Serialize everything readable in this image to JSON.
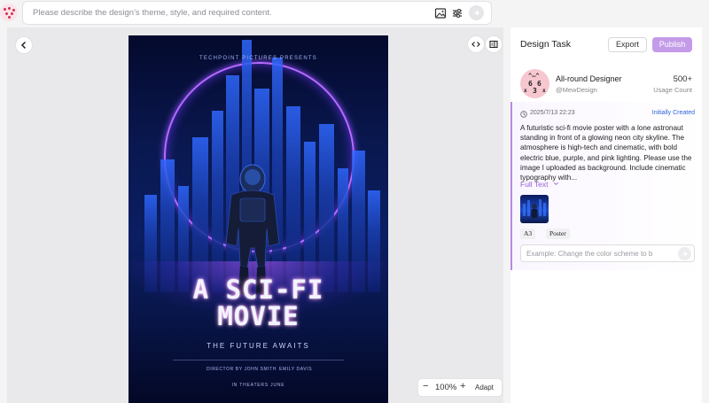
{
  "top_bar": {
    "prompt_placeholder": "Please describe the design's theme, style, and required content.",
    "icons": [
      "app-logo-icon",
      "image-upload-icon",
      "settings-sliders-icon",
      "send-arrow-icon"
    ]
  },
  "canvas": {
    "zoom": {
      "value": "100%",
      "minus": "−",
      "plus": "+",
      "adapt_label": "Adapt"
    }
  },
  "poster": {
    "studio": "TECHPOINT PICTURES PRESENTS",
    "title_line1": "A SCI-FI",
    "title_line2": "MOVIE",
    "subtitle": "THE FUTURE AWAITS",
    "credit_director": "DIRECTOR BY JOHN SMITH",
    "credit_actor": "EMILY DAVIS",
    "release": "IN THEATERS JUNE"
  },
  "panel": {
    "title": "Design Task",
    "export_label": "Export",
    "publish_label": "Publish",
    "designer": {
      "avatar_glyphs": [
        "^—^",
        "6",
        "6",
        "x",
        "3",
        "x"
      ],
      "name": "All-round Designer",
      "handle": "@MewDesign",
      "usage_value": "500+",
      "usage_label": "Usage Count"
    },
    "task": {
      "timestamp": "2025/7/13 22:23",
      "status": "Initially Created",
      "description": "A futuristic sci-fi movie poster with a lone astronaut standing in front of a glowing neon city skyline. The atmosphere is high-tech and cinematic, with bold electric blue, purple, and pink lighting. Please use the image I uploaded as background. Include cinematic typography with...",
      "full_text_label": "Full Text",
      "tags": [
        "A3",
        "Poster"
      ],
      "edit_placeholder": "Example: Change the color scheme to b"
    }
  },
  "colors": {
    "accent": "#c49be8",
    "status_blue": "#2e63d6",
    "poster_bg": "#0a1850"
  }
}
